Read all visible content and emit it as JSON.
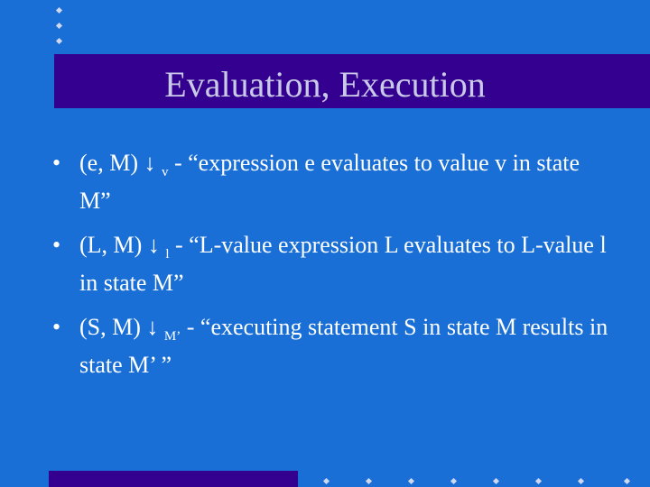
{
  "slide": {
    "title": "Evaluation, Execution",
    "bullets": [
      {
        "marker": "•",
        "head": "(e, M) ↓",
        "subscript": "v",
        "tail": "  -  “expression e evaluates to value v in state M”"
      },
      {
        "marker": "•",
        "head": "(L, M) ↓",
        "subscript": "l",
        "tail": "  -  “L-value expression L evaluates to L-value l in state M”"
      },
      {
        "marker": "•",
        "head": "(S, M) ↓",
        "subscript": "M’",
        "tail": "  - “executing statement S in state M results in state M’ ”"
      }
    ]
  },
  "colors": {
    "background": "#1a6fd6",
    "accent_bar": "#34008f",
    "title_text": "#c9c9e8",
    "body_text": "#ffffff"
  }
}
